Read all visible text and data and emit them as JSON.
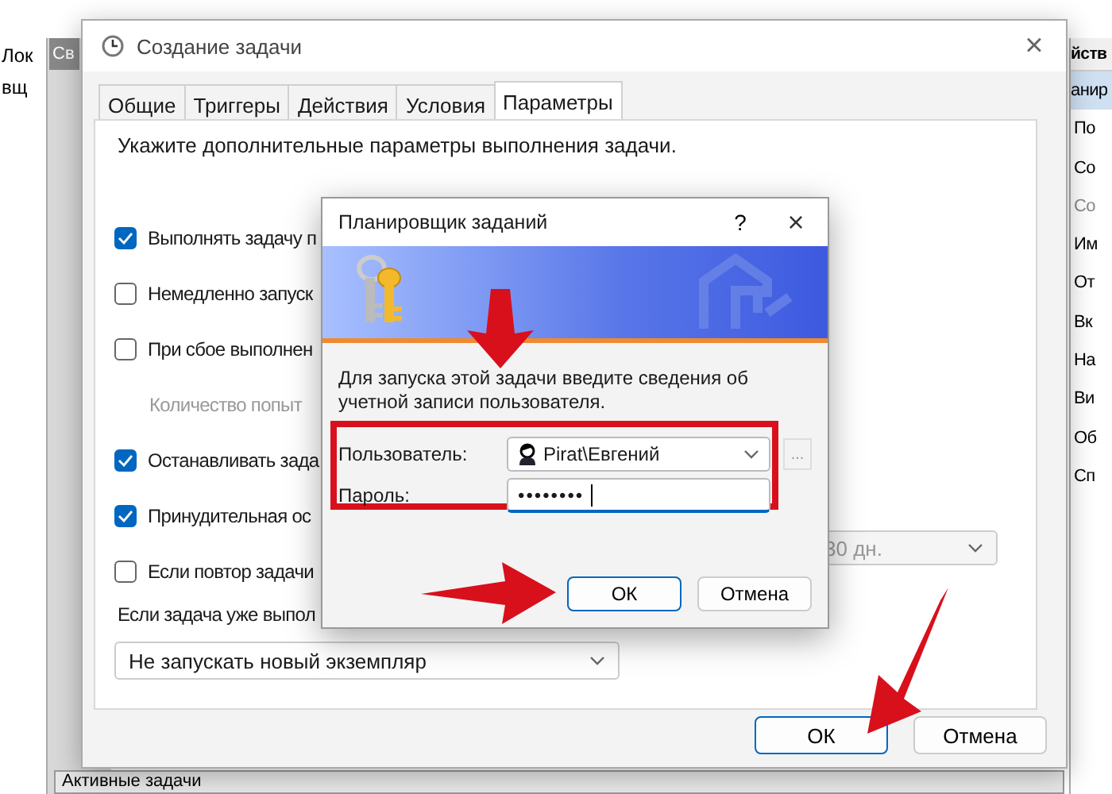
{
  "background_app": {
    "left_pane": [
      "Лок",
      "вщ"
    ],
    "tab": "Св",
    "actions_header": "йств",
    "actions": [
      {
        "label": "анир",
        "selected": true,
        "disabled": false
      },
      {
        "label": "По",
        "selected": false,
        "disabled": false
      },
      {
        "label": "Со",
        "selected": false,
        "disabled": false
      },
      {
        "label": "Со",
        "selected": false,
        "disabled": true
      },
      {
        "label": "Им",
        "selected": false,
        "disabled": false
      },
      {
        "label": "От",
        "selected": false,
        "disabled": false
      },
      {
        "label": "Вк",
        "selected": false,
        "disabled": false
      },
      {
        "label": "На",
        "selected": false,
        "disabled": false
      },
      {
        "label": "Ви",
        "selected": false,
        "disabled": false
      },
      {
        "label": "Об",
        "selected": false,
        "disabled": false
      },
      {
        "label": "Сп",
        "selected": false,
        "disabled": false
      }
    ],
    "bottom_tab": "Активные задачи"
  },
  "task_dialog": {
    "title": "Создание задачи",
    "close": "×",
    "tabs": [
      {
        "label": "Общие",
        "selected": false
      },
      {
        "label": "Триггеры",
        "selected": false
      },
      {
        "label": "Действия",
        "selected": false
      },
      {
        "label": "Условия",
        "selected": false
      },
      {
        "label": "Параметры",
        "selected": true
      }
    ],
    "intro": "Укажите дополнительные параметры выполнения задачи.",
    "settings": [
      {
        "kind": "checkbox",
        "label": "Выполнять задачу п",
        "checked": true
      },
      {
        "kind": "checkbox",
        "label": "Немедленно запуск",
        "checked": false
      },
      {
        "kind": "checkbox",
        "label": "При сбое выполнен",
        "checked": false
      },
      {
        "kind": "note",
        "label": "Количество попыт",
        "disabled": true
      },
      {
        "kind": "checkbox",
        "label": "Останавливать зада",
        "checked": true
      },
      {
        "kind": "checkbox",
        "label": "Принудительная ос",
        "checked": true
      },
      {
        "kind": "checkbox",
        "label": "Если повтор задачи",
        "checked": false
      }
    ],
    "delete_after": {
      "value": "30 дн.",
      "disabled": true
    },
    "running_rule_label": "Если задача уже выпол",
    "running_rule": {
      "value": "Не запускать новый экземпляр"
    },
    "buttons": [
      {
        "label": "ОК",
        "default": true
      },
      {
        "label": "Отмена",
        "default": false
      }
    ]
  },
  "credentials_dialog": {
    "title": "Планировщик заданий",
    "help": "?",
    "close": "×",
    "message": "Для запуска этой задачи введите сведения об учетной записи пользователя.",
    "user_label": "Пользователь:",
    "user": "Pirat\\Евгений",
    "browse": "...",
    "password_label": "Пароль:",
    "password": "••••••••",
    "buttons": [
      {
        "label": "ОК",
        "default": true
      },
      {
        "label": "Отмена",
        "default": false
      }
    ]
  }
}
